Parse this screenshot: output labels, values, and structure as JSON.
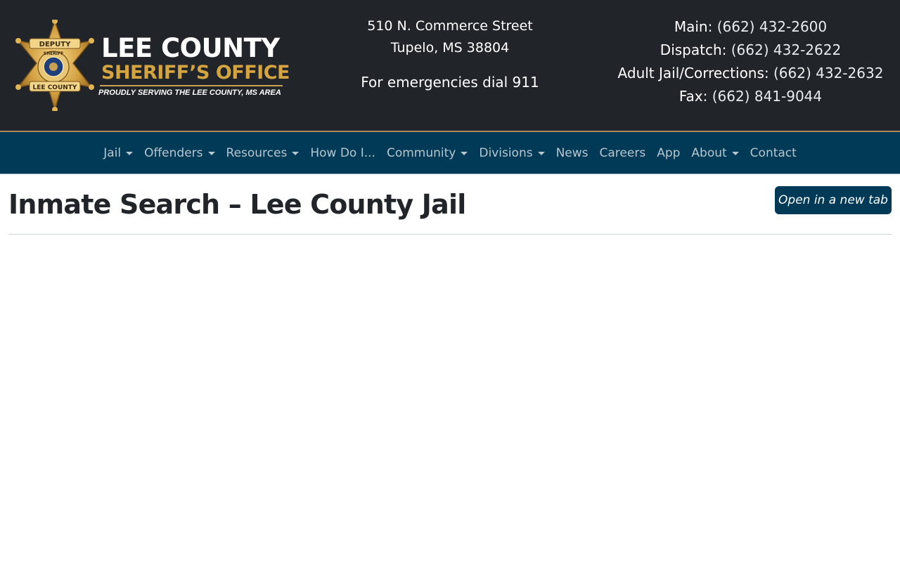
{
  "header": {
    "logo": {
      "title": "LEE COUNTY",
      "subtitle": "SHERIFF’S OFFICE",
      "tagline": "PROUDLY SERVING THE LEE COUNTY, MS AREA",
      "badge_top": "DEPUTY",
      "badge_ring": "SHERIFF",
      "badge_bottom": "LEE COUNTY"
    },
    "address": {
      "street": "510 N. Commerce Street",
      "city": "Tupelo, MS 38804",
      "emergency": "For emergencies dial 911"
    },
    "contacts": [
      {
        "label": "Main:",
        "number": "(662) 432-2600"
      },
      {
        "label": "Dispatch:",
        "number": "(662) 432-2622"
      },
      {
        "label": "Adult Jail/Corrections:",
        "number": "(662) 432-2632"
      },
      {
        "label": "Fax:",
        "number": "(662) 841-9044"
      }
    ]
  },
  "nav": [
    {
      "label": "Jail",
      "dropdown": true
    },
    {
      "label": "Offenders",
      "dropdown": true
    },
    {
      "label": "Resources",
      "dropdown": true
    },
    {
      "label": "How Do I...",
      "dropdown": false
    },
    {
      "label": "Community",
      "dropdown": true
    },
    {
      "label": "Divisions",
      "dropdown": true
    },
    {
      "label": "News",
      "dropdown": false
    },
    {
      "label": "Careers",
      "dropdown": false
    },
    {
      "label": "App",
      "dropdown": false
    },
    {
      "label": "About",
      "dropdown": true
    },
    {
      "label": "Contact",
      "dropdown": false
    }
  ],
  "main": {
    "title": "Inmate Search – Lee County Jail",
    "open_tab_label": "Open in a new tab"
  },
  "colors": {
    "header_bg": "#212529",
    "nav_bg": "#003a57",
    "gold": "#d4a441",
    "button_bg": "#003a57"
  }
}
